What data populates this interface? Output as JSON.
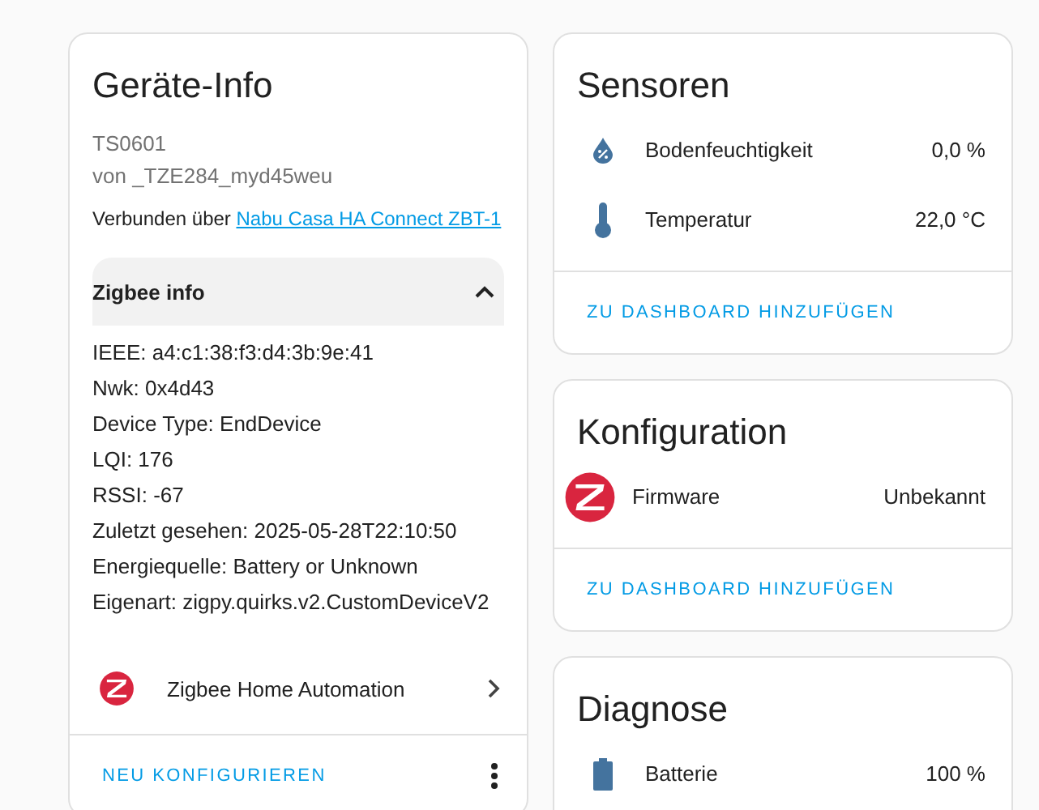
{
  "device_info": {
    "title": "Geräte-Info",
    "model": "TS0601",
    "manufacturer": "von _TZE284_myd45weu",
    "connected_prefix": "Verbunden über",
    "connected_link": "Nabu Casa HA Connect ZBT-1",
    "zigbee_info": {
      "title": "Zigbee info",
      "expanded": true,
      "lines": [
        "IEEE: a4:c1:38:f3:d4:3b:9e:41",
        "Nwk: 0x4d43",
        "Device Type: EndDevice",
        "LQI: 176",
        "RSSI: -67",
        "Zuletzt gesehen: 2025-05-28T22:10:50",
        "Energiequelle: Battery or Unknown",
        "Eigenart: zigpy.quirks.v2.CustomDeviceV2"
      ]
    },
    "integration": {
      "name": "Zigbee Home Automation"
    },
    "reconfigure_button": "NEU KONFIGURIEREN"
  },
  "cards": [
    {
      "title": "Sensoren",
      "entities": [
        {
          "kind": "moisture",
          "name": "Bodenfeuchtigkeit",
          "value": "0,0 %"
        },
        {
          "kind": "thermometer",
          "name": "Temperatur",
          "value": "22,0 °C"
        }
      ],
      "action": "ZU DASHBOARD HINZUFÜGEN"
    },
    {
      "title": "Konfiguration",
      "entities": [
        {
          "kind": "zigbee",
          "name": "Firmware",
          "value": "Unbekannt"
        }
      ],
      "action": "ZU DASHBOARD HINZUFÜGEN"
    },
    {
      "title": "Diagnose",
      "entities": [
        {
          "kind": "battery",
          "name": "Batterie",
          "value": "100 %"
        }
      ]
    }
  ]
}
